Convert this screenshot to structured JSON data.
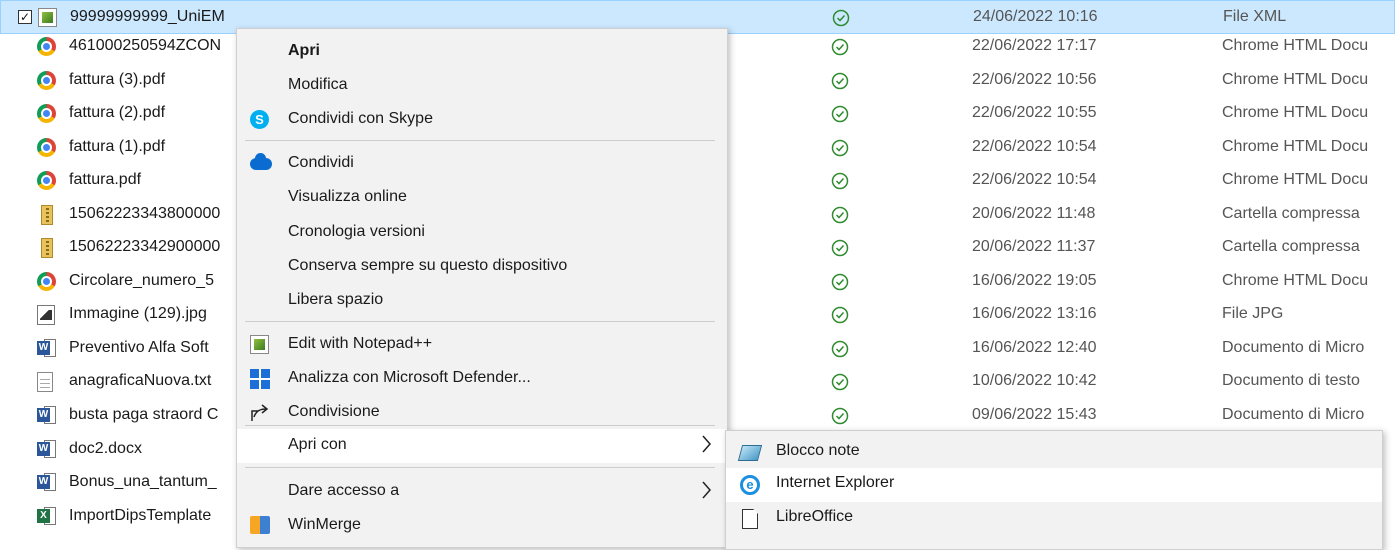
{
  "files": [
    {
      "name": "99999999999_UniEM",
      "date": "24/06/2022 10:16",
      "type": "File XML",
      "icon": "notepad-plus-icon",
      "selected": true
    },
    {
      "name": "461000250594ZCON",
      "date": "22/06/2022 17:17",
      "type": "Chrome HTML Docu",
      "icon": "chrome-icon"
    },
    {
      "name": "fattura (3).pdf",
      "date": "22/06/2022 10:56",
      "type": "Chrome HTML Docu",
      "icon": "chrome-icon"
    },
    {
      "name": "fattura (2).pdf",
      "date": "22/06/2022 10:55",
      "type": "Chrome HTML Docu",
      "icon": "chrome-icon"
    },
    {
      "name": "fattura (1).pdf",
      "date": "22/06/2022 10:54",
      "type": "Chrome HTML Docu",
      "icon": "chrome-icon"
    },
    {
      "name": "fattura.pdf",
      "date": "22/06/2022 10:54",
      "type": "Chrome HTML Docu",
      "icon": "chrome-icon"
    },
    {
      "name": "15062223343800000",
      "date": "20/06/2022 11:48",
      "type": "Cartella compressa",
      "icon": "zip-folder-icon"
    },
    {
      "name": "15062223342900000",
      "date": "20/06/2022 11:37",
      "type": "Cartella compressa",
      "icon": "zip-folder-icon"
    },
    {
      "name": "Circolare_numero_5",
      "date": "16/06/2022 19:05",
      "type": "Chrome HTML Docu",
      "icon": "chrome-icon"
    },
    {
      "name": "Immagine (129).jpg",
      "date": "16/06/2022 13:16",
      "type": "File JPG",
      "icon": "image-file-icon"
    },
    {
      "name": "Preventivo Alfa Soft",
      "date": "16/06/2022 12:40",
      "type": "Documento di Micro",
      "icon": "word-icon"
    },
    {
      "name": "anagraficaNuova.txt",
      "date": "10/06/2022 10:42",
      "type": "Documento di testo",
      "icon": "text-file-icon"
    },
    {
      "name": "busta paga straord C",
      "date": "09/06/2022 15:43",
      "type": "Documento di Micro",
      "icon": "word-icon"
    },
    {
      "name": "doc2.docx",
      "date": "",
      "type": "",
      "icon": "word-icon"
    },
    {
      "name": "Bonus_una_tantum_",
      "date": "",
      "type": "",
      "icon": "word-icon"
    },
    {
      "name": "ImportDipsTemplate",
      "date": "",
      "type": "",
      "icon": "excel-icon"
    }
  ],
  "context_menu": {
    "open": "Apri",
    "edit": "Modifica",
    "share_skype": "Condividi con Skype",
    "share": "Condividi",
    "view_online": "Visualizza online",
    "version_history": "Cronologia versioni",
    "always_keep": "Conserva sempre su questo dispositivo",
    "free_space": "Libera spazio",
    "edit_notepadpp": "Edit with Notepad++",
    "defender_scan": "Analizza con Microsoft Defender...",
    "sharing": "Condivisione",
    "open_with": "Apri con",
    "give_access": "Dare accesso a",
    "winmerge": "WinMerge"
  },
  "open_with_submenu": {
    "notepad": "Blocco note",
    "internet_explorer": "Internet Explorer",
    "libreoffice": "LibreOffice"
  },
  "colors": {
    "selection_bg": "#cce8ff",
    "status_green": "#2e8b2e",
    "menu_bg": "#f2f2f2"
  }
}
